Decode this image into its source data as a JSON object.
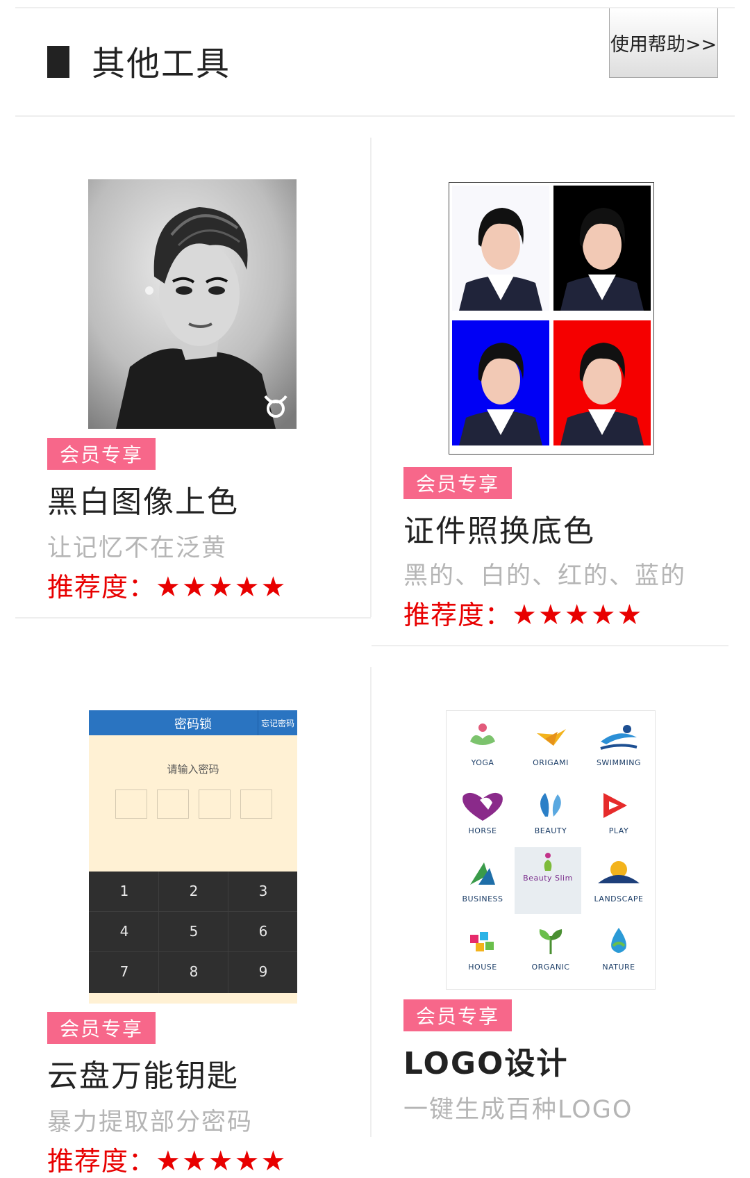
{
  "header": {
    "title": "其他工具",
    "help_label": "使用帮助>>"
  },
  "cards": [
    {
      "badge": "会员专享",
      "title": "黑白图像上色",
      "desc": "让记忆不在泛黄",
      "rating_label": "推荐度：",
      "stars": "★★★★★",
      "rating": 5
    },
    {
      "badge": "会员专享",
      "title": "证件照换底色",
      "desc": "黑的、白的、红的、蓝的",
      "rating_label": "推荐度：",
      "stars": "★★★★★",
      "rating": 5
    },
    {
      "badge": "会员专享",
      "title": "云盘万能钥匙",
      "desc": "暴力提取部分密码",
      "rating_label": "推荐度：",
      "stars": "★★★★★",
      "rating": 5
    },
    {
      "badge": "会员专享",
      "title": "LOGO设计",
      "desc": "一键生成百种LOGO",
      "rating_label": "推荐度：",
      "stars": "★★★★★",
      "rating": 5
    }
  ],
  "id_photo": {
    "backgrounds": [
      "#ffffff",
      "#000000",
      "#0000ff",
      "#ff0000"
    ]
  },
  "lock_screen": {
    "title": "密码锁",
    "forgot": "忘记密码",
    "prompt": "请输入密码",
    "keys": [
      "1",
      "2",
      "3",
      "4",
      "5",
      "6",
      "7",
      "8",
      "9"
    ]
  },
  "logo_samples": {
    "items": [
      "YOGA",
      "ORIGAMI",
      "SWIMMING",
      "HORSE",
      "BEAUTY",
      "PLAY",
      "BUSINESS",
      "Beauty Slim",
      "LANDSCAPE",
      "HOUSE",
      "ORGANIC",
      "NATURE"
    ]
  },
  "colors": {
    "badge": "#f7678a",
    "rating": "#e80000",
    "accent_blue": "#2a74c1"
  }
}
